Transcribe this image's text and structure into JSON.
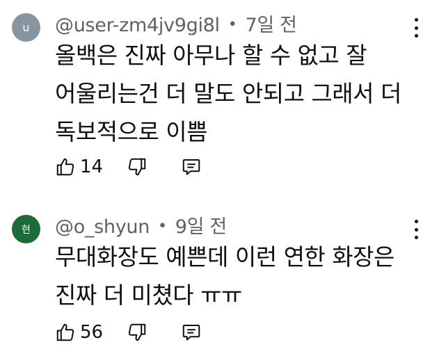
{
  "comments": [
    {
      "avatar_letter": "u",
      "username": "@user-zm4jv9gi8l",
      "separator": "•",
      "time": "7일 전",
      "lines": [
        "올백은 진짜 아무나 할 수 없고 잘",
        "어울리는건 더 말도 안되고 그래서 더",
        "독보적으로 이쁨"
      ],
      "likes": "14",
      "avatar_color": "#8696a0"
    },
    {
      "avatar_letter": "현",
      "username": "@o_shyun",
      "separator": "•",
      "time": "9일 전",
      "lines": [
        "무대화장도 예쁜데 이런 연한 화장은",
        "진짜 더 미쳤다 ㅠㅠ"
      ],
      "likes": "56",
      "avatar_color": "#1e6b3a"
    }
  ],
  "icons": {
    "like": "thumbs-up-icon",
    "dislike": "thumbs-down-icon",
    "reply": "reply-comment-icon",
    "menu": "more-vertical-icon"
  }
}
